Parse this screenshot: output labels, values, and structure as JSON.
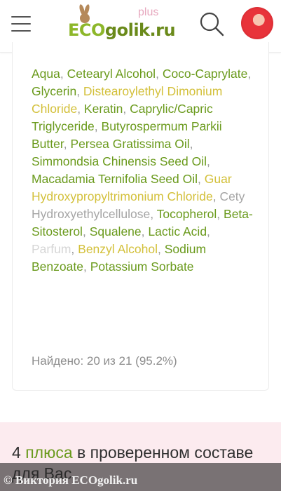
{
  "header": {
    "logo_main_eco": "ECO",
    "logo_main_rest": "golik.ru",
    "logo_plus": "plus"
  },
  "ingredients": [
    {
      "name": "Aqua",
      "status": "good"
    },
    {
      "name": "Cetearyl Alcohol",
      "status": "good"
    },
    {
      "name": "Coco-Caprylate",
      "status": "good"
    },
    {
      "name": "Glycerin",
      "status": "good"
    },
    {
      "name": "Distearoylethyl Dimonium Chloride",
      "status": "warn"
    },
    {
      "name": "Keratin",
      "status": "good"
    },
    {
      "name": "Caprylic/Capric Triglyceride",
      "status": "good"
    },
    {
      "name": "Butyrospermum Parkii Butter",
      "status": "good"
    },
    {
      "name": "Persea Gratissima Oil",
      "status": "good"
    },
    {
      "name": "Simmondsia Chinensis Seed Oil",
      "status": "good"
    },
    {
      "name": "Macadamia Ternifolia Seed Oil",
      "status": "good"
    },
    {
      "name": "Guar Hydroxypropyltrimonium Chloride",
      "status": "warn"
    },
    {
      "name": "Cety Hydroxyethylcellulose",
      "status": "neutral"
    },
    {
      "name": "Tocopherol",
      "status": "good"
    },
    {
      "name": "Beta-Sitosterol",
      "status": "good"
    },
    {
      "name": "Squalene",
      "status": "good"
    },
    {
      "name": "Lactic Acid",
      "status": "good"
    },
    {
      "name": "Parfum",
      "status": "light"
    },
    {
      "name": "Benzyl Alcohol",
      "status": "warn"
    },
    {
      "name": "Sodium Benzoate",
      "status": "good"
    },
    {
      "name": "Potassium Sorbate",
      "status": "good"
    }
  ],
  "found_text": "Найдено: 20 из 21 (95.2%)",
  "pros_section": {
    "count": "4",
    "highlight": "плюса",
    "rest": "в проверенном составе для Вас"
  },
  "watermark": "© Виктория ECOgolik.ru",
  "colors": {
    "good": "#6a9a1c",
    "warn": "#d3c03a",
    "neutral": "#a5a5a5",
    "light": "#d6d6d6",
    "pink_bg": "#fcebef"
  }
}
